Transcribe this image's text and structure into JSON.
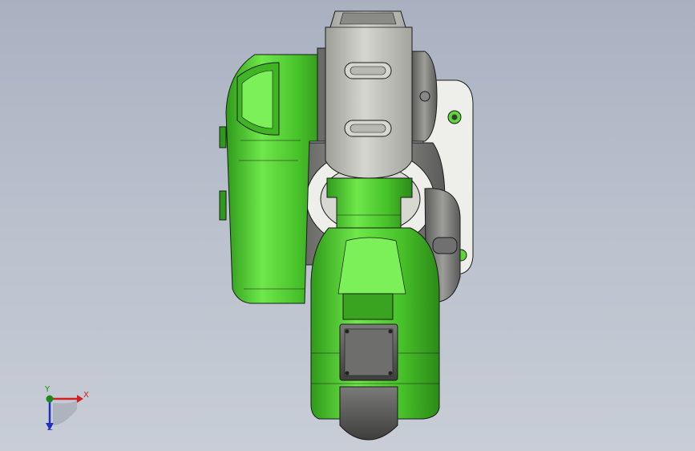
{
  "viewport": {
    "background_top": "#a9b1c1",
    "background_bottom": "#c8cdd6"
  },
  "model": {
    "name": "robot-arm-assembly",
    "primary_color": "#5ed63a",
    "secondary_color": "#8a8a88",
    "housing_color": "#c9c9c4",
    "edge_color": "#1a1a1a"
  },
  "triad": {
    "x_label": "X",
    "y_label": "Y",
    "z_label": "Z",
    "x_color": "#d02020",
    "y_color": "#1a8a1a",
    "z_color": "#2030c0"
  }
}
